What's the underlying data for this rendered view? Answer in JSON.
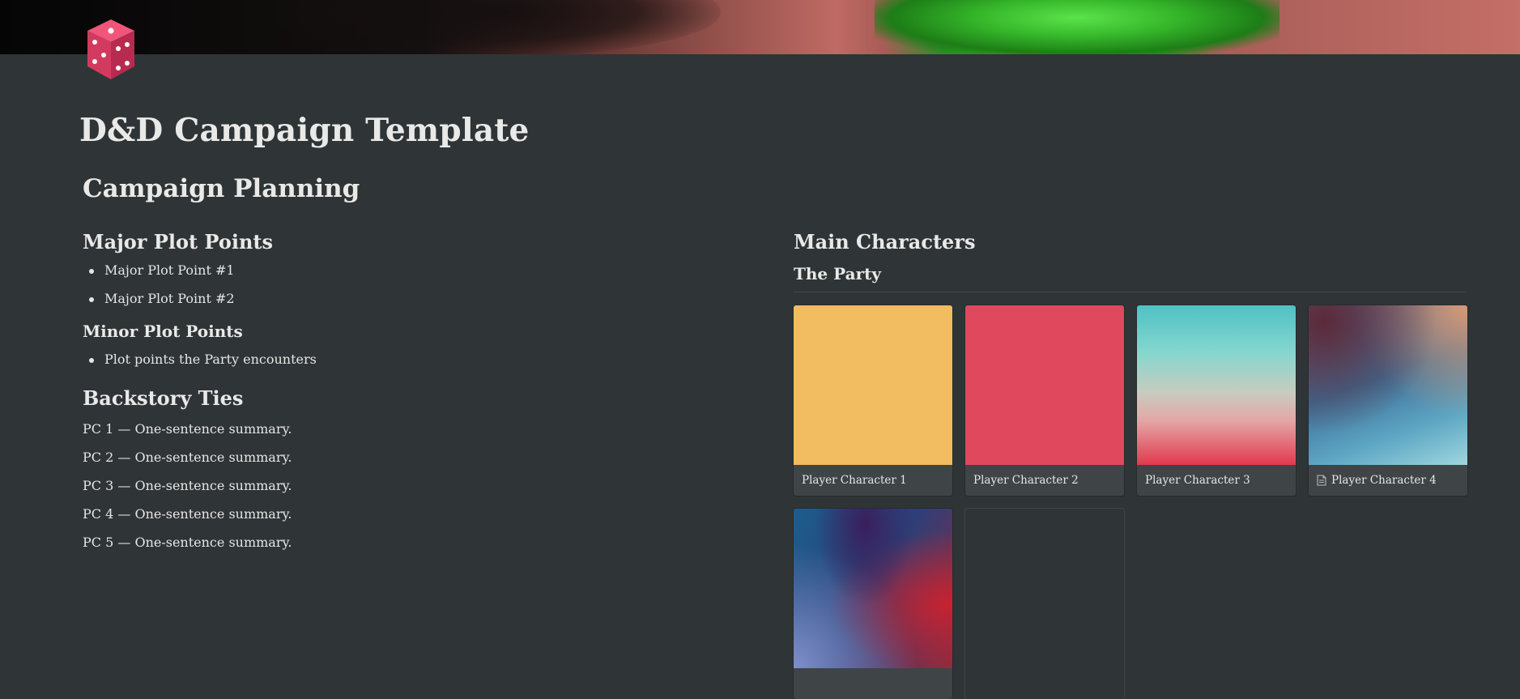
{
  "page": {
    "icon": "red-die-icon",
    "title": "D&D Campaign Template"
  },
  "planning": {
    "heading": "Campaign Planning",
    "major": {
      "heading": "Major Plot Points",
      "items": [
        "Major Plot Point #1",
        "Major Plot Point #2"
      ]
    },
    "minor": {
      "heading": "Minor Plot Points",
      "items": [
        "Plot points the Party encounters"
      ]
    },
    "backstory": {
      "heading": "Backstory Ties",
      "items": [
        "PC 1 — One-sentence summary.",
        "PC 2 — One-sentence summary.",
        "PC 3 — One-sentence summary.",
        "PC 4 — One-sentence summary.",
        "PC 5 — One-sentence summary."
      ]
    }
  },
  "characters": {
    "heading": "Main Characters",
    "party_heading": "The Party",
    "cards": [
      {
        "label": "Player Character 1",
        "cover": "yellow"
      },
      {
        "label": "Player Character 2",
        "cover": "red"
      },
      {
        "label": "Player Character 3",
        "cover": "teal-gradient"
      },
      {
        "label": "Player Character 4",
        "cover": "dusk-gradient",
        "icon": "document-icon"
      }
    ]
  },
  "colors": {
    "background": "#2f3437",
    "text": "#e6e6e4",
    "card": "#3f4447"
  }
}
